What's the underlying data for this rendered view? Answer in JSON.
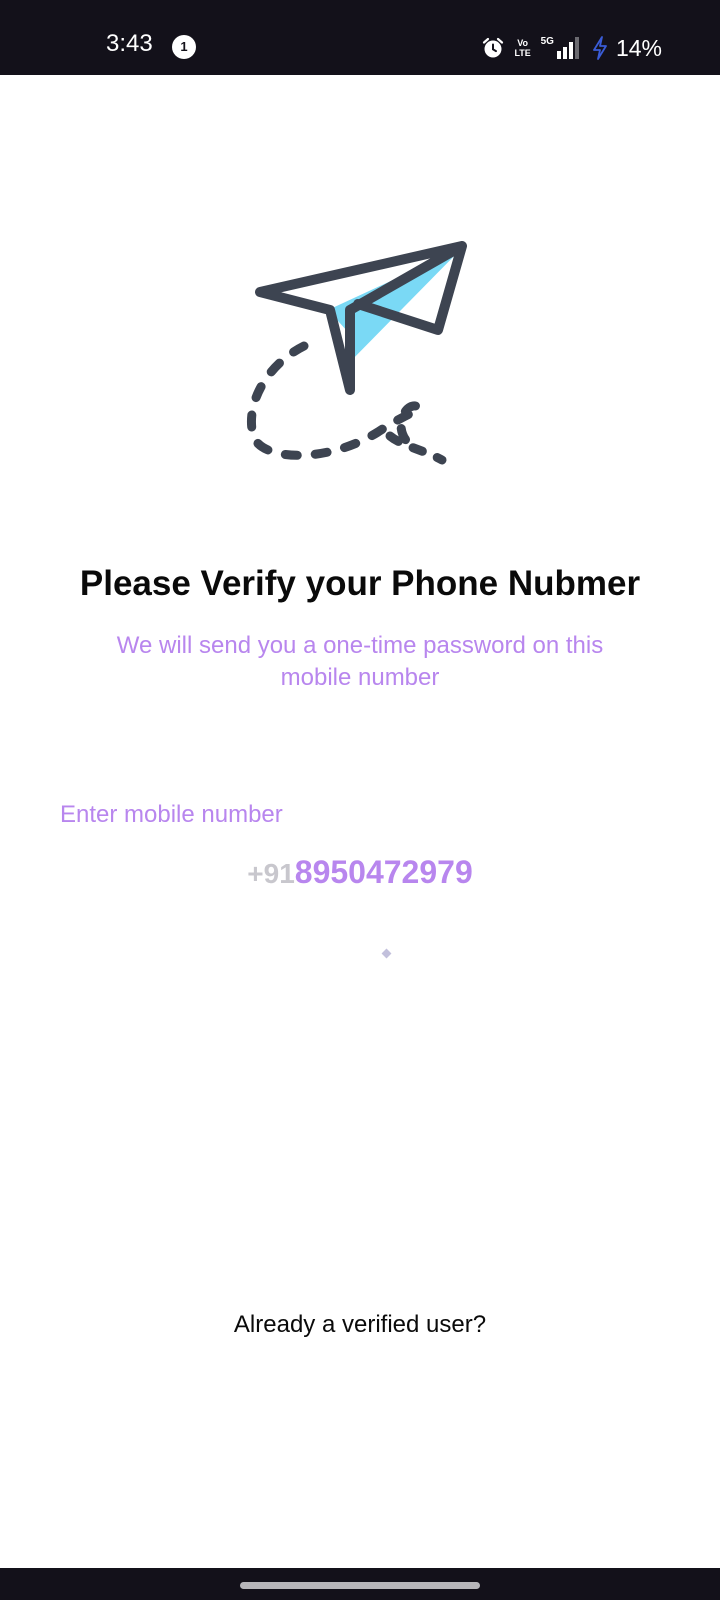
{
  "status_bar": {
    "time": "3:43",
    "notification_count": "1",
    "volte_top": "Vo",
    "volte_bottom": "LTE",
    "network_type": "5G",
    "battery_percent": "14%",
    "icons": [
      "alarm-icon",
      "volte-icon",
      "signal-icon",
      "charging-bolt-icon"
    ]
  },
  "hero": {
    "icon": "paper-plane-icon",
    "colors": {
      "outline": "#3d4451",
      "accent": "#7ad9f5"
    }
  },
  "verify": {
    "title": "Please Verify your Phone Nubmer",
    "subtitle": "We will send you a one-time password on this mobile number"
  },
  "mobile_input": {
    "label": "Enter mobile number",
    "country_code": "+91",
    "value": "8950472979"
  },
  "footer": {
    "verified_link": "Already a verified user?"
  },
  "colors": {
    "accent_purple": "#b886ee",
    "title_text": "#0a0a0a",
    "country_code_gray": "#c8c7cd",
    "status_bar_bg": "#13111a",
    "charging_bolt": "#3a5cd6"
  }
}
